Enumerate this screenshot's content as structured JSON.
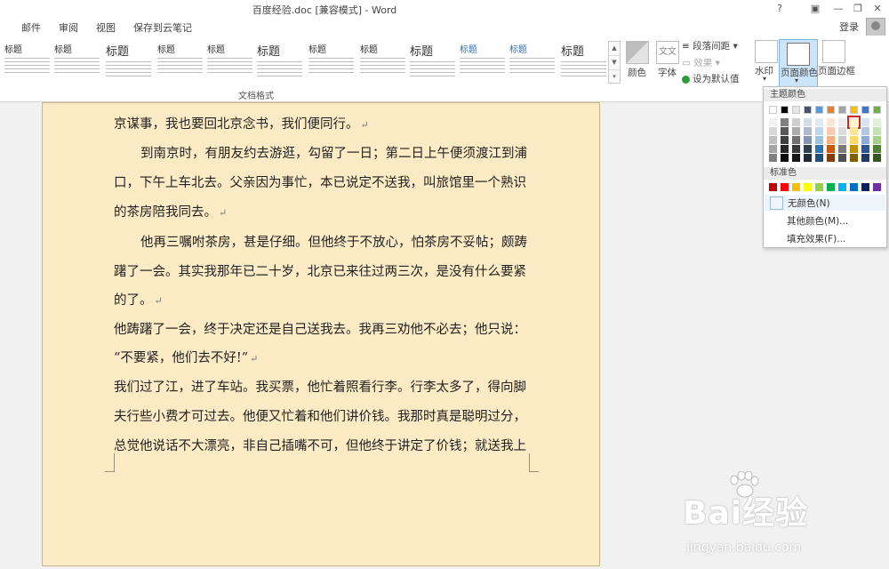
{
  "window": {
    "title": "百度经验.doc [兼容模式] - Word",
    "buttons": [
      "?",
      "▣",
      "—",
      "❐",
      "✕"
    ]
  },
  "tabs": [
    {
      "label": "邮件"
    },
    {
      "label": "审阅"
    },
    {
      "label": "视图"
    },
    {
      "label": "保存到云笔记"
    }
  ],
  "account": {
    "login_label": "登录"
  },
  "ribbon": {
    "styles_group_label": "文档格式",
    "style_headings": [
      "标题",
      "标题",
      "标题",
      "标题",
      "标题",
      "标题",
      "标题",
      "标题",
      "标题",
      "标题",
      "标题",
      "标题"
    ],
    "colors_label": "颜色",
    "fonts_label": "字体",
    "paragraph_spacing_label": "段落间距",
    "effects_label": "效果",
    "set_default_label": "设为默认值",
    "watermark_label": "水印",
    "page_color_label": "页面颜色",
    "page_border_label": "页面边框",
    "fonts_icon_text": "文文"
  },
  "color_menu": {
    "theme_colors_title": "主题颜色",
    "standard_colors_title": "标准色",
    "no_color_label": "无颜色(N)",
    "more_colors_label": "其他颜色(M)...",
    "fill_effects_label": "填充效果(F)...",
    "theme_top": [
      "#ffffff",
      "#000000",
      "#e7e6e6",
      "#44546a",
      "#5b9bd5",
      "#ed7d31",
      "#a5a5a5",
      "#ffc000",
      "#4472c4",
      "#70ad47"
    ],
    "theme_shades": [
      [
        "#f2f2f2",
        "#7f7f7f",
        "#d0cece",
        "#d6dce4",
        "#deebf6",
        "#fbe5d5",
        "#ededed",
        "#fff2cc",
        "#d9e2f3",
        "#e2efd9"
      ],
      [
        "#d8d8d8",
        "#595959",
        "#aeabab",
        "#adb9ca",
        "#bdd7ee",
        "#f7cbac",
        "#dbdbdb",
        "#fee599",
        "#b4c6e7",
        "#c5e0b3"
      ],
      [
        "#bfbfbf",
        "#3f3f3f",
        "#757070",
        "#8496b0",
        "#9cc3e5",
        "#f4b183",
        "#c9c9c9",
        "#ffd965",
        "#8eaadb",
        "#a8d08d"
      ],
      [
        "#a5a5a5",
        "#262626",
        "#3a3838",
        "#323f4f",
        "#2e75b5",
        "#c55a11",
        "#7b7b7b",
        "#bf9000",
        "#2f5496",
        "#538135"
      ],
      [
        "#7f7f7f",
        "#0c0c0c",
        "#171616",
        "#222a35",
        "#1e4e79",
        "#833c0b",
        "#525252",
        "#7f6000",
        "#1f3864",
        "#375623"
      ]
    ],
    "selected": {
      "row": 1,
      "col": 7
    },
    "standard": [
      "#c00000",
      "#ff0000",
      "#ffc000",
      "#ffff00",
      "#92d050",
      "#00b050",
      "#00b0f0",
      "#0070c0",
      "#002060",
      "#7030a0"
    ]
  },
  "document": {
    "page_color": "#fcebc4",
    "paragraphs": [
      {
        "text": "京谋事，我也要回北京念书，我们便同行。",
        "mark": "↵"
      },
      {
        "text": "到南京时，有朋友约去游逛，勾留了一日；第二日上午便须渡江到浦",
        "mark": ""
      },
      {
        "text": "口，下午上车北去。父亲因为事忙，本已说定不送我，叫旅馆里一个熟识",
        "mark": ""
      },
      {
        "text": "的茶房陪我同去。",
        "mark": "↵"
      },
      {
        "text": "他再三嘱咐茶房，甚是仔细。但他终于不放心，怕茶房不妥帖；颇踌",
        "mark": ""
      },
      {
        "text": "躇了一会。其实我那年已二十岁，北京已来往过两三次，是没有什么要紧",
        "mark": ""
      },
      {
        "text": "的了。",
        "mark": "↵"
      },
      {
        "text": "他踌躇了一会，终于决定还是自己送我去。我再三劝他不必去；他只说：",
        "mark": ""
      },
      {
        "text": "“不要紧，他们去不好!”",
        "mark": "↵"
      },
      {
        "text": "我们过了江，进了车站。我买票，他忙着照看行李。行李太多了，得向脚",
        "mark": ""
      },
      {
        "text": "夫行些小费才可过去。他便又忙着和他们讲价钱。我那时真是聪明过分，",
        "mark": ""
      },
      {
        "text": "总觉他说话不大漂亮，非自己插嘴不可，但他终于讲定了价钱；就送我上",
        "mark": ""
      }
    ]
  },
  "watermark": {
    "logo": "Bai经验",
    "url": "jingyan.baidu.com"
  }
}
